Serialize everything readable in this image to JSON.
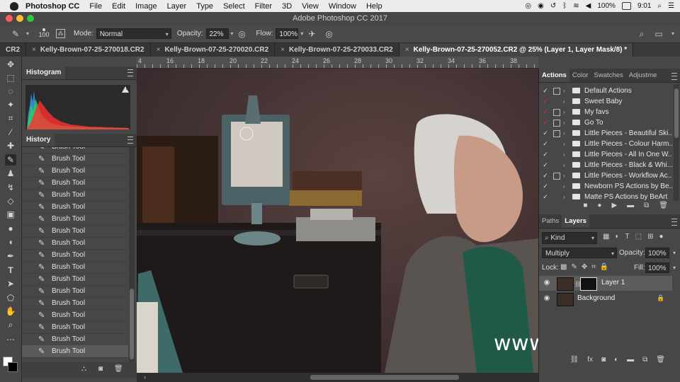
{
  "menubar": {
    "app": "Photoshop CC",
    "items": [
      "File",
      "Edit",
      "Image",
      "Layer",
      "Type",
      "Select",
      "Filter",
      "3D",
      "View",
      "Window",
      "Help"
    ],
    "battery": "100%",
    "time": "9:01"
  },
  "window": {
    "title": "Adobe Photoshop CC 2017"
  },
  "options": {
    "brush_size": "100",
    "mode_label": "Mode:",
    "mode_value": "Normal",
    "opacity_label": "Opacity:",
    "opacity_value": "22%",
    "flow_label": "Flow:",
    "flow_value": "100%"
  },
  "tabs": [
    {
      "label": "CR2"
    },
    {
      "label": "Kelly-Brown-07-25-270018.CR2"
    },
    {
      "label": "Kelly-Brown-07-25-270020.CR2"
    },
    {
      "label": "Kelly-Brown-07-25-270033.CR2"
    },
    {
      "label": "Kelly-Brown-07-25-270052.CR2 @ 25% (Layer 1, Layer Mask/8) *"
    }
  ],
  "ruler": [
    "4",
    "16",
    "18",
    "20",
    "22",
    "24",
    "26",
    "28",
    "30",
    "32",
    "34",
    "36",
    "38"
  ],
  "histogram": {
    "title": "Histogram",
    "warning": "!"
  },
  "history": {
    "title": "History",
    "items": [
      "Brush Tool",
      "Brush Tool",
      "Brush Tool",
      "Brush Tool",
      "Brush Tool",
      "Brush Tool",
      "Brush Tool",
      "Brush Tool",
      "Brush Tool",
      "Brush Tool",
      "Brush Tool",
      "Brush Tool",
      "Brush Tool",
      "Brush Tool",
      "Brush Tool",
      "Brush Tool",
      "Brush Tool",
      "Brush Tool"
    ]
  },
  "actions_panel": {
    "tabs": [
      "Actions",
      "Color",
      "Swatches",
      "Adjustme"
    ],
    "items": [
      "Default Actions",
      "Sweet Baby",
      "My favs",
      "Go To",
      "Little Pieces - Beautiful Ski...",
      "Little Pieces - Colour Harm...",
      "Little Pieces - All In One W...",
      "Little Pieces - Black & Whi...",
      "Little Pieces - Workflow Ac...",
      "Newborn PS Actions by Be...",
      "Matte PS Actions by BeArt"
    ]
  },
  "layers_panel": {
    "tabs": [
      "Paths",
      "Layers"
    ],
    "filter": "Kind",
    "blend_mode": "Multiply",
    "opacity_label": "Opacity:",
    "opacity_value": "100%",
    "lock_label": "Lock:",
    "fill_label": "Fill:",
    "fill_value": "100%",
    "layers": [
      "Layer 1",
      "Background"
    ]
  },
  "watermark": "www.hunls.com"
}
